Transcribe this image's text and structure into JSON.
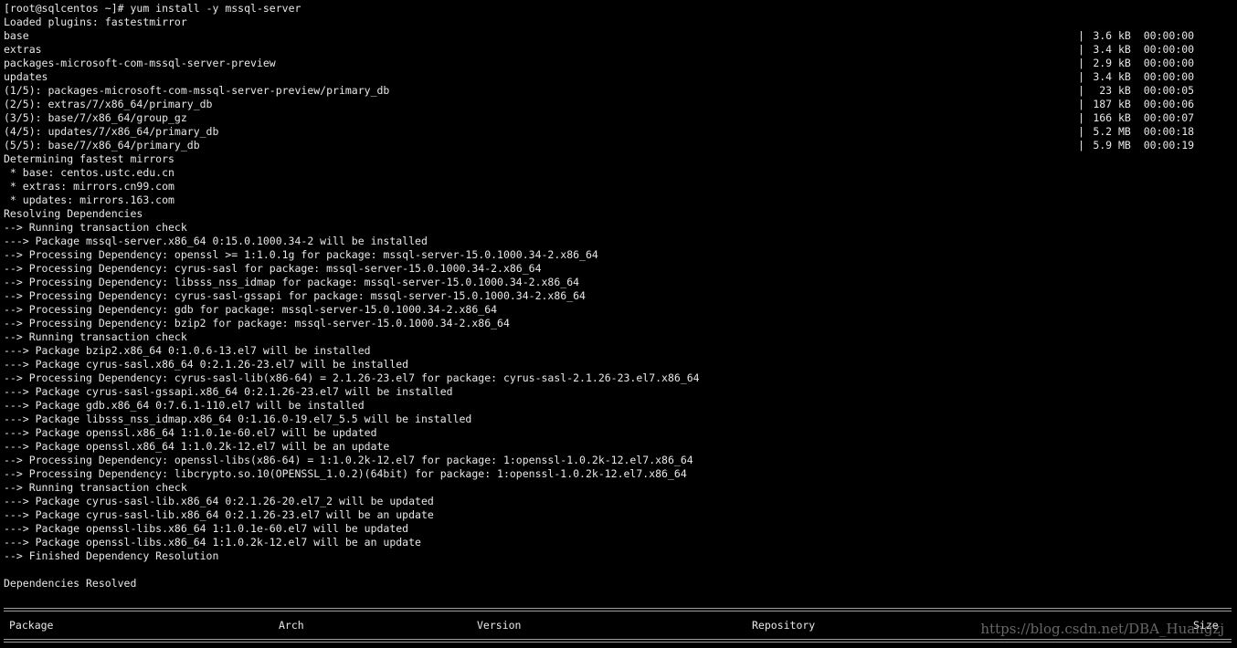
{
  "terminal": {
    "prompt": "[root@sqlcentos ~]# ",
    "command": "yum install -y mssql-server",
    "loaded_plugins": "Loaded plugins: fastestmirror",
    "downloads": [
      {
        "name": "base",
        "size": "3.6 kB",
        "time": "00:00:00"
      },
      {
        "name": "extras",
        "size": "3.4 kB",
        "time": "00:00:00"
      },
      {
        "name": "packages-microsoft-com-mssql-server-preview",
        "size": "2.9 kB",
        "time": "00:00:00"
      },
      {
        "name": "updates",
        "size": "3.4 kB",
        "time": "00:00:00"
      },
      {
        "name": "(1/5): packages-microsoft-com-mssql-server-preview/primary_db",
        "size": "23 kB",
        "time": "00:00:05"
      },
      {
        "name": "(2/5): extras/7/x86_64/primary_db",
        "size": "187 kB",
        "time": "00:00:06"
      },
      {
        "name": "(3/5): base/7/x86_64/group_gz",
        "size": "166 kB",
        "time": "00:00:07"
      },
      {
        "name": "(4/5): updates/7/x86_64/primary_db",
        "size": "5.2 MB",
        "time": "00:00:18"
      },
      {
        "name": "(5/5): base/7/x86_64/primary_db",
        "size": "5.9 MB",
        "time": "00:00:19"
      }
    ],
    "lines": [
      "Determining fastest mirrors",
      " * base: centos.ustc.edu.cn",
      " * extras: mirrors.cn99.com",
      " * updates: mirrors.163.com",
      "Resolving Dependencies",
      "--> Running transaction check",
      "---> Package mssql-server.x86_64 0:15.0.1000.34-2 will be installed",
      "--> Processing Dependency: openssl >= 1:1.0.1g for package: mssql-server-15.0.1000.34-2.x86_64",
      "--> Processing Dependency: cyrus-sasl for package: mssql-server-15.0.1000.34-2.x86_64",
      "--> Processing Dependency: libsss_nss_idmap for package: mssql-server-15.0.1000.34-2.x86_64",
      "--> Processing Dependency: cyrus-sasl-gssapi for package: mssql-server-15.0.1000.34-2.x86_64",
      "--> Processing Dependency: gdb for package: mssql-server-15.0.1000.34-2.x86_64",
      "--> Processing Dependency: bzip2 for package: mssql-server-15.0.1000.34-2.x86_64",
      "--> Running transaction check",
      "---> Package bzip2.x86_64 0:1.0.6-13.el7 will be installed",
      "---> Package cyrus-sasl.x86_64 0:2.1.26-23.el7 will be installed",
      "--> Processing Dependency: cyrus-sasl-lib(x86-64) = 2.1.26-23.el7 for package: cyrus-sasl-2.1.26-23.el7.x86_64",
      "---> Package cyrus-sasl-gssapi.x86_64 0:2.1.26-23.el7 will be installed",
      "---> Package gdb.x86_64 0:7.6.1-110.el7 will be installed",
      "---> Package libsss_nss_idmap.x86_64 0:1.16.0-19.el7_5.5 will be installed",
      "---> Package openssl.x86_64 1:1.0.1e-60.el7 will be updated",
      "---> Package openssl.x86_64 1:1.0.2k-12.el7 will be an update",
      "--> Processing Dependency: openssl-libs(x86-64) = 1:1.0.2k-12.el7 for package: 1:openssl-1.0.2k-12.el7.x86_64",
      "--> Processing Dependency: libcrypto.so.10(OPENSSL_1.0.2)(64bit) for package: 1:openssl-1.0.2k-12.el7.x86_64",
      "--> Running transaction check",
      "---> Package cyrus-sasl-lib.x86_64 0:2.1.26-20.el7_2 will be updated",
      "---> Package cyrus-sasl-lib.x86_64 0:2.1.26-23.el7 will be an update",
      "---> Package openssl-libs.x86_64 1:1.0.1e-60.el7 will be updated",
      "---> Package openssl-libs.x86_64 1:1.0.2k-12.el7 will be an update",
      "--> Finished Dependency Resolution",
      "",
      "Dependencies Resolved"
    ],
    "table_header": {
      "package": "Package",
      "arch": "Arch",
      "version": "Version",
      "repository": "Repository",
      "size": "Size"
    },
    "watermark": "https://blog.csdn.net/DBA_Huangzj"
  },
  "colors": {
    "background": "#000000",
    "foreground": "#e8e8e8"
  }
}
